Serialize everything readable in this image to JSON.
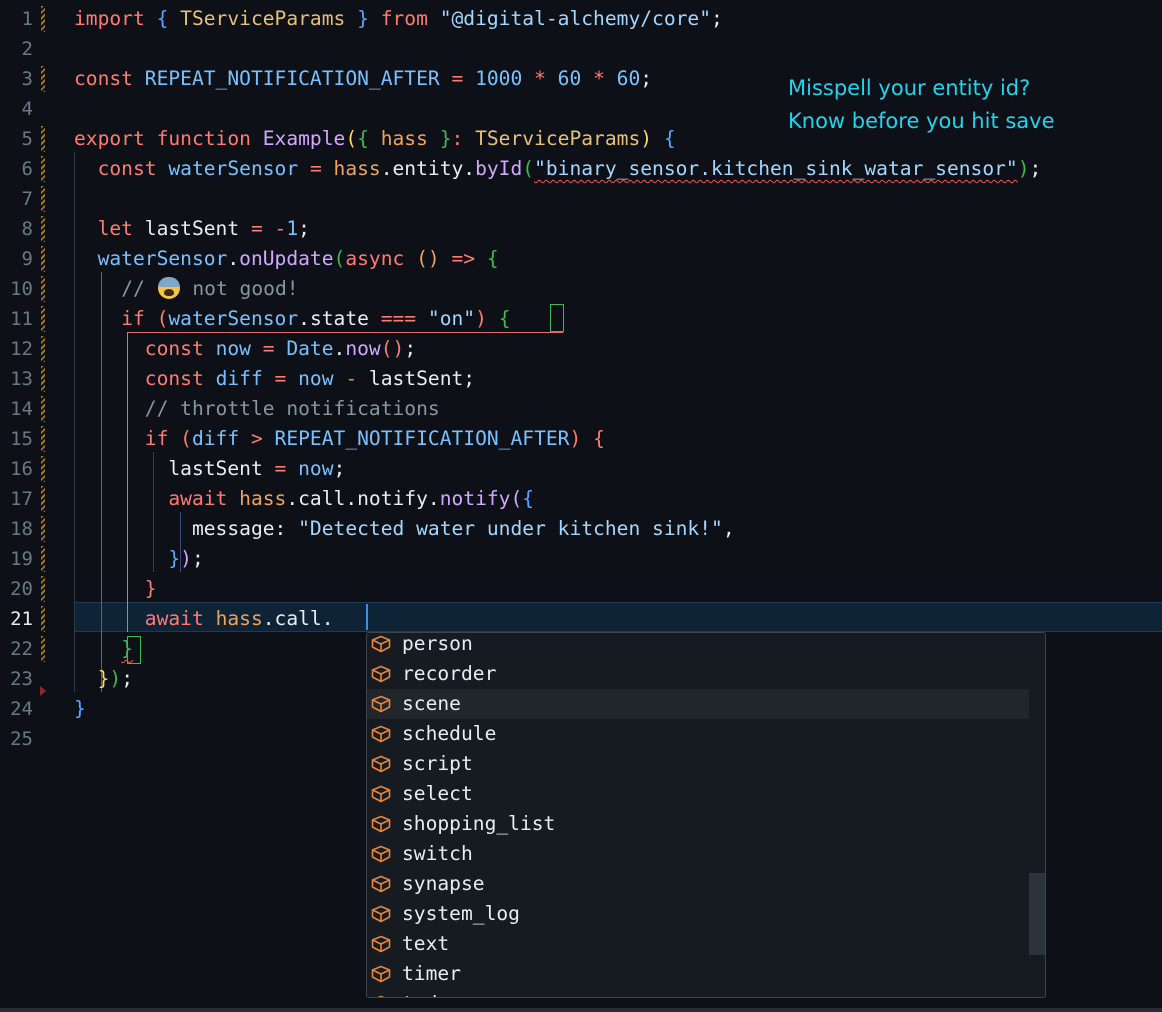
{
  "editor": {
    "active_line": 21,
    "lines": [
      {
        "n": "1"
      },
      {
        "n": "2"
      },
      {
        "n": "3"
      },
      {
        "n": "4"
      },
      {
        "n": "5"
      },
      {
        "n": "6"
      },
      {
        "n": "7"
      },
      {
        "n": "8"
      },
      {
        "n": "9"
      },
      {
        "n": "10"
      },
      {
        "n": "11"
      },
      {
        "n": "12"
      },
      {
        "n": "13"
      },
      {
        "n": "14"
      },
      {
        "n": "15"
      },
      {
        "n": "16"
      },
      {
        "n": "17"
      },
      {
        "n": "18"
      },
      {
        "n": "19"
      },
      {
        "n": "20"
      },
      {
        "n": "21"
      },
      {
        "n": "22"
      },
      {
        "n": "23"
      },
      {
        "n": "24"
      },
      {
        "n": "25"
      }
    ],
    "tokens": {
      "l1": [
        "import",
        " ",
        "{",
        " TServiceParams ",
        "}",
        " ",
        "from",
        " ",
        "\"@digital-alchemy/core\"",
        ";"
      ],
      "l3": [
        "const",
        " ",
        "REPEAT_NOTIFICATION_AFTER",
        " ",
        "=",
        " ",
        "1000",
        " ",
        "*",
        " ",
        "60",
        " ",
        "*",
        " ",
        "60",
        ";"
      ],
      "l5": [
        "export",
        " ",
        "function",
        " ",
        "Example",
        "(",
        "{",
        " ",
        "hass",
        " ",
        "}",
        ": ",
        "TServiceParams",
        ")",
        " ",
        "{"
      ],
      "l6": [
        "  ",
        "const",
        " ",
        "waterSensor",
        " ",
        "=",
        " ",
        "hass",
        ".",
        "entity",
        ".",
        "byId",
        "(",
        "\"binary_sensor.kitchen_sink_watar_sensor\"",
        ")",
        ";"
      ],
      "l8": [
        "  ",
        "let",
        " ",
        "lastSent",
        " ",
        "=",
        " ",
        "-",
        "1",
        ";"
      ],
      "l9": [
        "  ",
        "waterSensor",
        ".",
        "onUpdate",
        "(",
        "async",
        " ",
        "()",
        " ",
        "=>",
        " ",
        "{"
      ],
      "l10": [
        "    ",
        "// ",
        " not good!"
      ],
      "l11": [
        "    ",
        "if",
        " ",
        "(",
        "waterSensor",
        ".",
        "state",
        " ",
        "===",
        " ",
        "\"on\"",
        ")",
        " ",
        "{"
      ],
      "l12": [
        "      ",
        "const",
        " ",
        "now",
        " ",
        "=",
        " ",
        "Date",
        ".",
        "now",
        "()",
        ";"
      ],
      "l13": [
        "      ",
        "const",
        " ",
        "diff",
        " ",
        "=",
        " ",
        "now",
        " ",
        "-",
        " ",
        "lastSent",
        ";"
      ],
      "l14": [
        "      ",
        "// throttle notifications"
      ],
      "l15": [
        "      ",
        "if",
        " ",
        "(",
        "diff",
        " ",
        ">",
        " ",
        "REPEAT_NOTIFICATION_AFTER",
        ")",
        " ",
        "{"
      ],
      "l16": [
        "        ",
        "lastSent",
        " ",
        "=",
        " ",
        "now",
        ";"
      ],
      "l17": [
        "        ",
        "await",
        " ",
        "hass",
        ".",
        "call",
        ".",
        "notify",
        ".",
        "notify",
        "(",
        "{"
      ],
      "l18": [
        "          ",
        "message",
        ": ",
        "\"Detected water under kitchen sink!\"",
        ","
      ],
      "l19": [
        "        ",
        "}",
        ")",
        ";"
      ],
      "l20": [
        "      ",
        "}"
      ],
      "l21": [
        "      ",
        "await",
        " ",
        "hass",
        ".",
        "call",
        "."
      ],
      "l22": [
        "    ",
        "}"
      ],
      "l23": [
        "  ",
        "}",
        ")",
        ";"
      ],
      "l24": [
        "}"
      ]
    }
  },
  "annotation": {
    "line1": "Misspell your entity id?",
    "line2": "Know before you hit save"
  },
  "suggestions": {
    "icon": "module-cube-icon",
    "selected_index": 2,
    "items": [
      "person",
      "recorder",
      "scene",
      "schedule",
      "script",
      "select",
      "shopping_list",
      "switch",
      "synapse",
      "system_log",
      "text",
      "timer",
      "todo"
    ]
  },
  "colors": {
    "background": "#0d1117",
    "annotation": "#22d3ee",
    "error_squiggle": "#f85149",
    "cursor": "#3b8eea",
    "suggest_icon": "#e8863a"
  }
}
